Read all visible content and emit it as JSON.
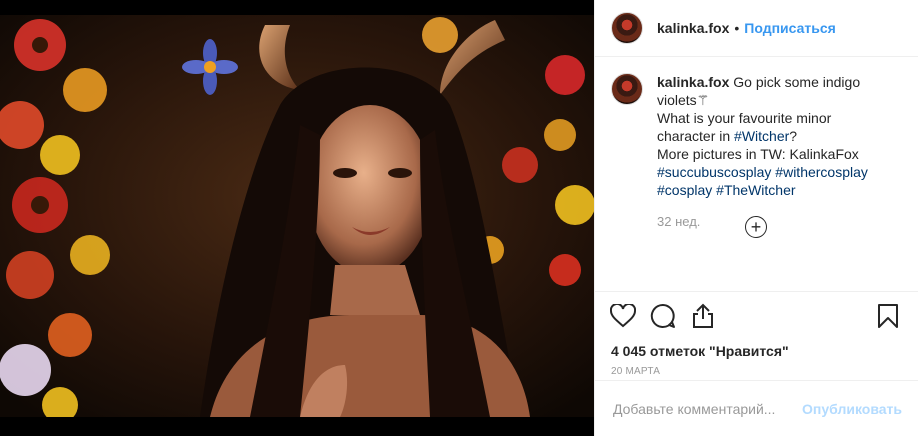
{
  "header": {
    "username": "kalinka.fox",
    "separator": "•",
    "follow_label": "Подписаться"
  },
  "caption": {
    "username": "kalinka.fox",
    "line1": "Go pick some indigo violets⚚",
    "line2_prefix": "What is your favourite minor character in ",
    "line2_tag": "#Witcher",
    "line2_suffix": "?",
    "line3": "More pictures in TW: KalinkaFox",
    "tags": [
      "#succubuscosplay",
      "#withercosplay",
      "#cosplay",
      "#TheWitcher"
    ],
    "age": "32 нед."
  },
  "stats": {
    "likes": "4 045 отметок \"Нравится\"",
    "date": "20 МАРТА"
  },
  "comment": {
    "placeholder": "Добавьте комментарий...",
    "publish_label": "Опубликовать"
  },
  "icons": [
    "heart-icon",
    "comment-icon",
    "share-icon",
    "bookmark-icon",
    "plus-circle-icon"
  ],
  "colors": {
    "link": "#3897f0",
    "hashtag": "#003569",
    "publish_disabled": "#b3dbff"
  }
}
